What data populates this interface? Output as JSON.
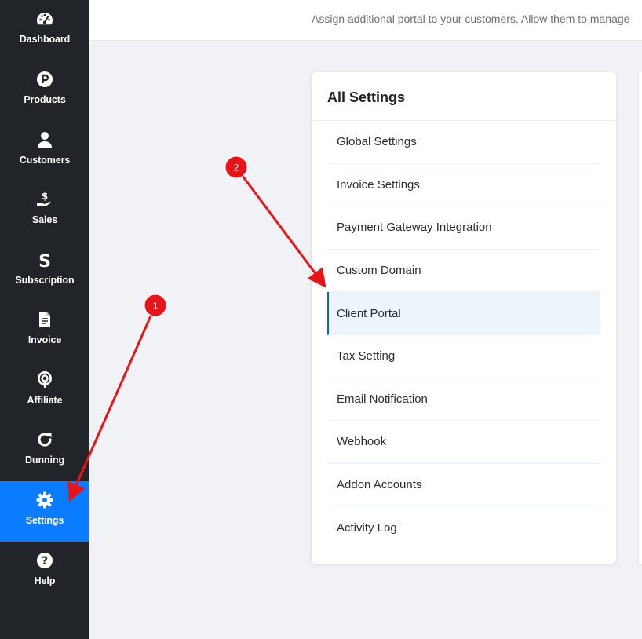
{
  "sidebar": {
    "items": [
      {
        "label": "Dashboard",
        "icon": "dashboard-gauge-icon"
      },
      {
        "label": "Products",
        "icon": "products-p-icon"
      },
      {
        "label": "Customers",
        "icon": "user-icon"
      },
      {
        "label": "Sales",
        "icon": "hand-dollar-icon"
      },
      {
        "label": "Subscription",
        "icon": "subscription-s-icon"
      },
      {
        "label": "Invoice",
        "icon": "document-icon"
      },
      {
        "label": "Affiliate",
        "icon": "broadcast-icon"
      },
      {
        "label": "Dunning",
        "icon": "refresh-icon"
      },
      {
        "label": "Settings",
        "icon": "gear-icon",
        "active": true
      },
      {
        "label": "Help",
        "icon": "question-icon"
      }
    ]
  },
  "header": {
    "subtitle": "Assign additional portal to your customers. Allow them to manage"
  },
  "settings_panel": {
    "title": "All Settings",
    "items": [
      {
        "label": "Global Settings"
      },
      {
        "label": "Invoice Settings"
      },
      {
        "label": "Payment Gateway Integration"
      },
      {
        "label": "Custom Domain"
      },
      {
        "label": "Client Portal",
        "active": true
      },
      {
        "label": "Tax Setting"
      },
      {
        "label": "Email Notification"
      },
      {
        "label": "Webhook"
      },
      {
        "label": "Addon Accounts"
      },
      {
        "label": "Activity Log"
      }
    ]
  },
  "annotations": {
    "step1": "1",
    "step2": "2"
  },
  "colors": {
    "sidebar_bg": "#212529",
    "active_nav": "#0a7cff",
    "annotation_red": "#e8141a",
    "active_item_bg": "#ecf4fc",
    "active_item_border": "#0a66c2"
  }
}
